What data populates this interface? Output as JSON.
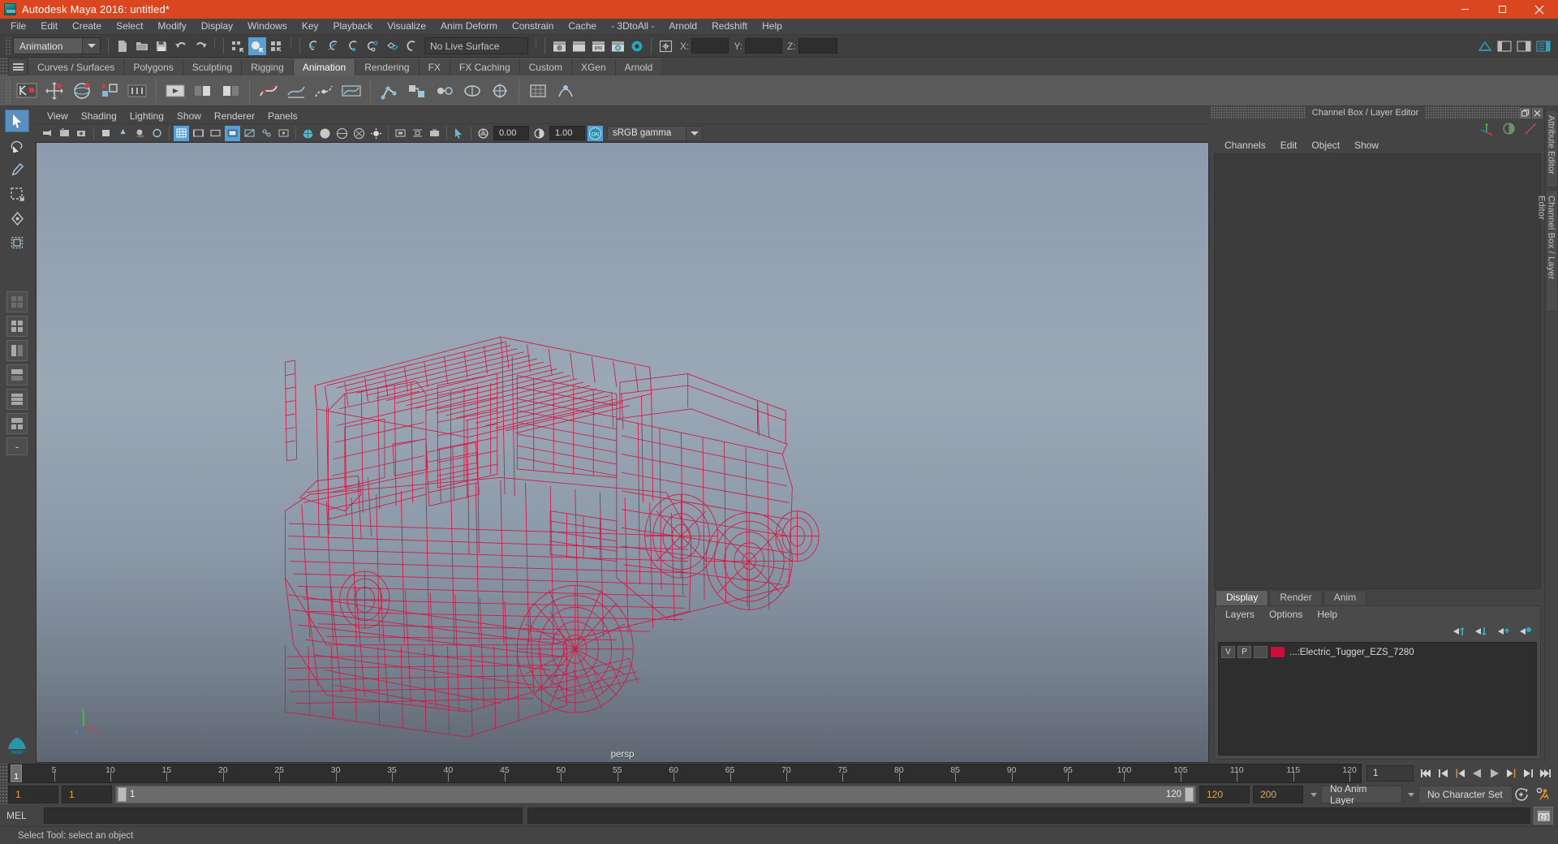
{
  "window": {
    "title": "Autodesk Maya 2016: untitled*",
    "app_icon": "maya-logo-icon",
    "controls": {
      "minimize": "minimize-icon",
      "maximize": "maximize-icon",
      "close": "close-icon"
    },
    "accent_color": "#d9461f"
  },
  "menubar": {
    "items": [
      "File",
      "Edit",
      "Create",
      "Select",
      "Modify",
      "Display",
      "Windows",
      "Key",
      "Playback",
      "Visualize",
      "Anim Deform",
      "Constrain",
      "Cache",
      "- 3DtoAll -",
      "Arnold",
      "Redshift",
      "Help"
    ]
  },
  "statusline": {
    "mode": {
      "value": "Animation",
      "icon": "chevron-down-icon"
    },
    "live_surface": "No Live Surface",
    "coords": {
      "xlabel": "X:",
      "xvalue": "",
      "ylabel": "Y:",
      "yvalue": "",
      "zlabel": "Z:",
      "zvalue": ""
    },
    "icons": [
      "new-scene-icon",
      "open-scene-icon",
      "save-scene-icon",
      "undo-icon",
      "redo-icon",
      "select-by-hierarchy-icon",
      "select-by-object-icon",
      "select-by-component-icon",
      "snap-grid-icon",
      "snap-curve-icon",
      "snap-point-icon",
      "snap-projected-center-icon",
      "snap-view-plane-icon",
      "snap-live-object-icon",
      "render-view-icon",
      "render-region-icon",
      "ipr-render-icon",
      "render-settings-icon",
      "hypershade-icon",
      "show-manipulator-icon",
      "toggle-panel-icon",
      "outliner-icon",
      "attribute-editor-icon",
      "channel-box-icon"
    ]
  },
  "shelf": {
    "tabs": [
      "Curves / Surfaces",
      "Polygons",
      "Sculpting",
      "Rigging",
      "Animation",
      "Rendering",
      "FX",
      "FX Caching",
      "Custom",
      "XGen",
      "Arnold"
    ],
    "active_tab": "Animation",
    "menu_icon": "shelf-menu-icon",
    "icons": [
      "set-key-icon",
      "set-key-translate-icon",
      "set-key-rotate-icon",
      "set-key-scale-icon",
      "breakdown-key-icon",
      "mute-key-icon",
      "playblast-icon",
      "ghost-prev-icon",
      "ghost-next-icon",
      "ghost-selected-icon",
      "bake-channel-icon",
      "bake-simulation-icon",
      "motion-trail-icon",
      "ik-handle-icon",
      "constraint-parent-icon",
      "constraint-point-icon",
      "constraint-orient-icon",
      "constraint-aim-icon",
      "deform-lattice-icon",
      "deform-cluster-icon"
    ]
  },
  "viewport": {
    "panel_menus": [
      "View",
      "Shading",
      "Lighting",
      "Show",
      "Renderer",
      "Panels"
    ],
    "camera_label": "persp",
    "exposure": "0.00",
    "gamma": "1.00",
    "color_management": {
      "value": "sRGB gamma",
      "toggle": "ON"
    },
    "background_top_color": "#8d9daf",
    "background_bottom_color": "#5d6772",
    "model": {
      "name": "Electric Tugger EZS 7280",
      "display": "wireframe",
      "wire_color": "#d41440"
    },
    "axis_gizmo": {
      "x": "x",
      "y": "y",
      "z": "z"
    },
    "toolbar_icons": [
      "select-tool-icon",
      "lasso-tool-icon",
      "paint-select-icon",
      "move-tool-icon",
      "rotate-tool-icon",
      "scale-tool-icon",
      "last-tool-icon",
      "grid-icon",
      "film-gate-icon",
      "resolution-gate-icon",
      "gate-mask-icon",
      "xray-icon",
      "xray-joints-icon",
      "smooth-shade-icon",
      "wireframe-on-shaded-icon",
      "textures-icon",
      "lights-icon",
      "shadows-icon",
      "screen-space-ao-icon",
      "motion-blur-icon",
      "multisample-icon",
      "isolate-select-icon",
      "exposure-icon",
      "gamma-icon",
      "color-management-icon"
    ]
  },
  "toolbox": {
    "tools": [
      "select-tool",
      "lasso-select-tool",
      "paint-select-tool",
      "move-tool",
      "rotate-tool",
      "scale-tool",
      "last-tool-used",
      "show-manipulator-tool"
    ],
    "layouts": [
      "single-perspective-layout",
      "four-view-layout",
      "persp-outliner-layout",
      "persp-graph-layout",
      "persp-hypershade-layout",
      "two-pane-stacked-layout",
      "three-pane-split-layout",
      "saved-layout"
    ]
  },
  "right_dock": {
    "panel_title": "Channel Box / Layer Editor",
    "window_buttons": [
      "undock-icon",
      "close-icon"
    ],
    "tool_icons": [
      "move-manip-icon",
      "shading-sphere-icon",
      "anim-curve-icon"
    ],
    "channel_menus": [
      "Channels",
      "Edit",
      "Object",
      "Show"
    ],
    "side_tabs": [
      "Attribute Editor",
      "Channel Box / Layer Editor"
    ],
    "layer_editor": {
      "tabs": [
        "Display",
        "Render",
        "Anim"
      ],
      "active_tab": "Display",
      "menus": [
        "Layers",
        "Options",
        "Help"
      ],
      "buttons": [
        "move-layer-up-icon",
        "move-layer-down-icon",
        "new-layer-icon",
        "new-layer-from-selected-icon"
      ],
      "layers": [
        {
          "visibility": "V",
          "playback": "P",
          "state": "",
          "color": "#c8103c",
          "name": "...:Electric_Tugger_EZS_7280"
        }
      ]
    }
  },
  "timeline": {
    "current_frame": "1",
    "frame_field": "1",
    "ticks": [
      "5",
      "10",
      "15",
      "20",
      "25",
      "30",
      "35",
      "40",
      "45",
      "50",
      "55",
      "60",
      "65",
      "70",
      "75",
      "80",
      "85",
      "90",
      "95",
      "100",
      "105",
      "110",
      "115",
      "120"
    ],
    "tick_start": 5,
    "tick_step": 5,
    "tick_end": 120,
    "playback_buttons": [
      "go-to-start-icon",
      "step-back-keyframe-icon",
      "step-back-frame-icon",
      "play-backwards-icon",
      "play-forwards-icon",
      "step-forward-frame-icon",
      "step-forward-keyframe-icon",
      "go-to-end-icon"
    ]
  },
  "range_slider": {
    "anim_start": "1",
    "range_start": "1",
    "bar_start": "1",
    "bar_end": "120",
    "range_end": "120",
    "anim_end": "200",
    "anim_layer": "No Anim Layer",
    "character_set": "No Character Set",
    "icons": [
      "auto-key-icon",
      "animation-preferences-icon"
    ]
  },
  "command_line": {
    "label": "MEL",
    "input_value": "",
    "output_value": "",
    "script_editor_icon": "script-editor-icon"
  },
  "status_bar": {
    "message": "Select Tool: select an object"
  }
}
